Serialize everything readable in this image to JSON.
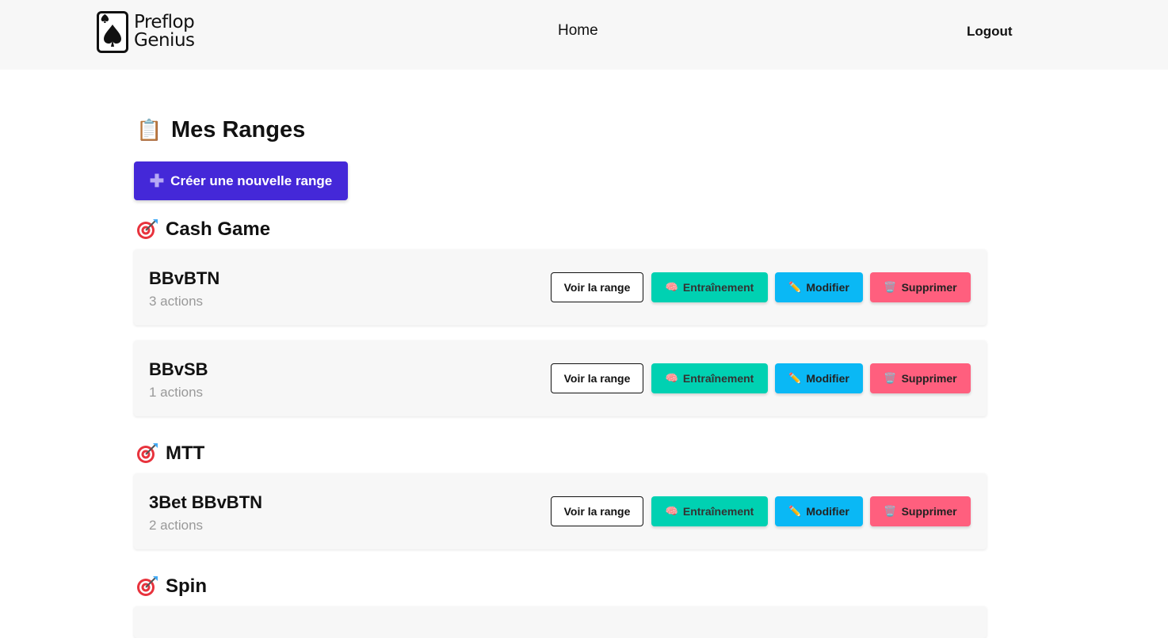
{
  "nav": {
    "logo_line1": "Preflop",
    "logo_line2": "Genius",
    "home": "Home",
    "logout": "Logout"
  },
  "page": {
    "title_emoji": "📋",
    "title": "Mes Ranges",
    "create_button": "Créer une nouvelle range",
    "create_icon": "plus-icon"
  },
  "button_labels": {
    "view": "Voir la range",
    "train": "Entraînement",
    "edit": "Modifier",
    "delete": "Supprimer"
  },
  "button_icons": {
    "train": "🧠",
    "edit": "✏️",
    "delete": "🗑️"
  },
  "colors": {
    "primary": "#4428d8",
    "train": "#00d1b2",
    "edit": "#0ab8f5",
    "delete": "#ff5f7e"
  },
  "sections": [
    {
      "title": "Cash Game",
      "icon": "target-icon",
      "ranges": [
        {
          "name": "BBvBTN",
          "actions": "3 actions"
        },
        {
          "name": "BBvSB",
          "actions": "1 actions"
        }
      ]
    },
    {
      "title": "MTT",
      "icon": "target-icon",
      "ranges": [
        {
          "name": "3Bet BBvBTN",
          "actions": "2 actions"
        }
      ]
    },
    {
      "title": "Spin",
      "icon": "target-icon",
      "ranges": []
    }
  ]
}
